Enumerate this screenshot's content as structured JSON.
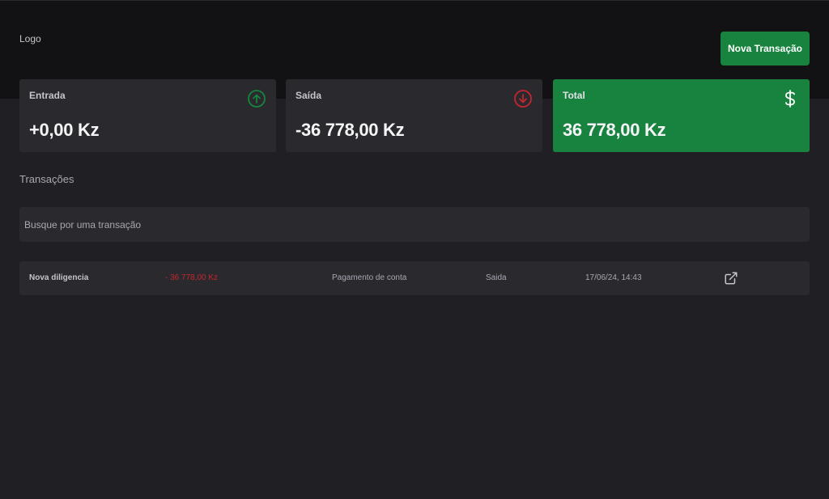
{
  "header": {
    "logo_text": "Logo",
    "new_transaction_label": "Nova Transação"
  },
  "summary": {
    "income": {
      "label": "Entrada",
      "value": "+0,00 Kz",
      "icon": "arrow-circle-up-icon",
      "color": "#17833f"
    },
    "outcome": {
      "label": "Saída",
      "value": "-36 778,00 Kz",
      "icon": "arrow-circle-down-icon",
      "color": "#c4262f"
    },
    "total": {
      "label": "Total",
      "value": "36 778,00 Kz",
      "icon": "dollar-icon",
      "color": "#17833f"
    }
  },
  "transactions": {
    "title": "Transações",
    "search_placeholder": "Busque por uma transação",
    "rows": [
      {
        "description": "Nova diligencia",
        "amount": "- 36 778,00 Kz",
        "category": "Pagamento de conta",
        "type": "Saida",
        "date": "17/06/24, 14:43",
        "action_icon": "external-link-icon"
      }
    ]
  }
}
